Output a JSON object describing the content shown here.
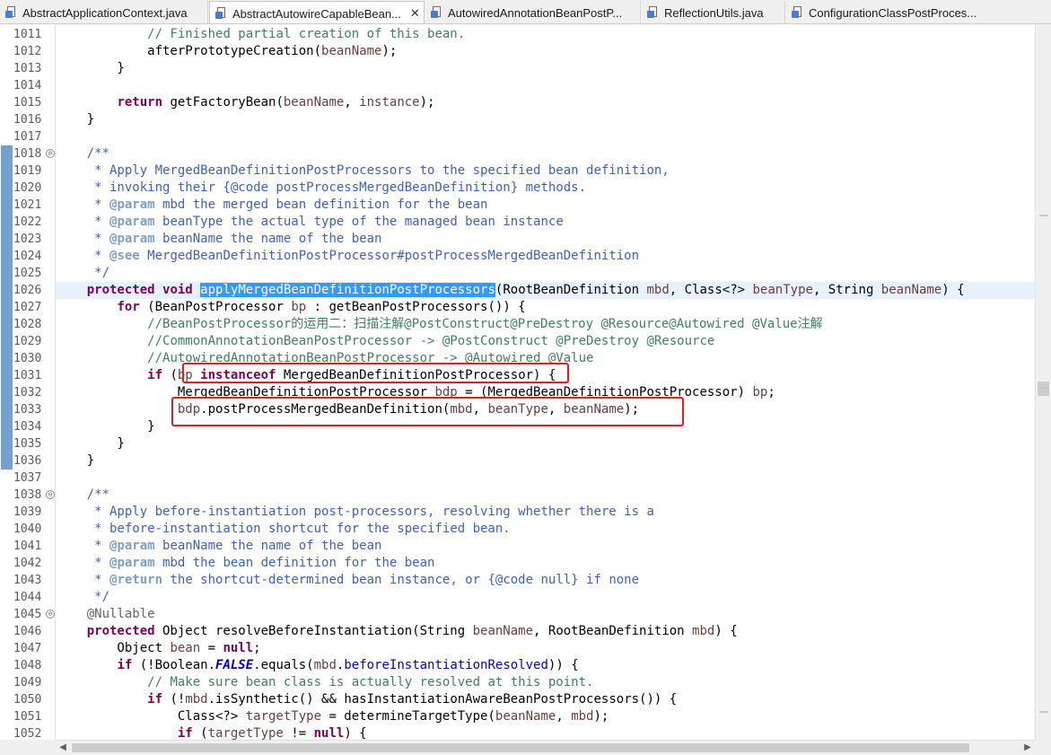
{
  "tabs": [
    {
      "label": "AbstractApplicationContext.java",
      "active": false
    },
    {
      "label": "AbstractAutowireCapableBean...",
      "active": true,
      "close": "✕"
    },
    {
      "label": "AutowiredAnnotationBeanPostP...",
      "active": false
    },
    {
      "label": "ReflectionUtils.java",
      "active": false
    },
    {
      "label": "ConfigurationClassPostProces...",
      "active": false
    }
  ],
  "colors": {
    "keyword": "#7f0055",
    "comment": "#3f7f5f",
    "javadoc": "#3f5fbf",
    "javadoc_tag": "#7f9fbf",
    "local_variable": "#6a3e3e",
    "field": "#0000c0",
    "selection": "#3399ff",
    "highlight_box": "#e02020",
    "current_line": "#e8f2fe"
  },
  "editor": {
    "lines": [
      {
        "num": "1011",
        "segs": [
          {
            "t": "            "
          },
          {
            "t": "// Finished partial creation of this bean.",
            "c": "cm"
          }
        ]
      },
      {
        "num": "1012",
        "segs": [
          {
            "t": "            afterPrototypeCreation("
          },
          {
            "t": "beanName",
            "c": "var"
          },
          {
            "t": ");"
          }
        ]
      },
      {
        "num": "1013",
        "segs": [
          {
            "t": "        }"
          }
        ]
      },
      {
        "num": "1014",
        "segs": [
          {
            "t": ""
          }
        ]
      },
      {
        "num": "1015",
        "segs": [
          {
            "t": "        "
          },
          {
            "t": "return",
            "c": "kw"
          },
          {
            "t": " getFactoryBean("
          },
          {
            "t": "beanName",
            "c": "var"
          },
          {
            "t": ", "
          },
          {
            "t": "instance",
            "c": "var"
          },
          {
            "t": ");"
          }
        ]
      },
      {
        "num": "1016",
        "segs": [
          {
            "t": "    }"
          }
        ]
      },
      {
        "num": "1017",
        "segs": [
          {
            "t": ""
          }
        ]
      },
      {
        "num": "1018",
        "fold": "⊖",
        "mark": true,
        "segs": [
          {
            "t": "    "
          },
          {
            "t": "/**",
            "c": "jd"
          }
        ]
      },
      {
        "num": "1019",
        "mark": true,
        "segs": [
          {
            "t": "     * Apply MergedBeanDefinitionPostProcessors to the specified bean definition,",
            "c": "jd"
          }
        ]
      },
      {
        "num": "1020",
        "mark": true,
        "segs": [
          {
            "t": "     * invoking their {@code postProcessMergedBeanDefinition} methods.",
            "c": "jd"
          }
        ]
      },
      {
        "num": "1021",
        "mark": true,
        "segs": [
          {
            "t": "     * ",
            "c": "jd"
          },
          {
            "t": "@param",
            "c": "jt"
          },
          {
            "t": " mbd the merged bean definition for the bean",
            "c": "jd"
          }
        ]
      },
      {
        "num": "1022",
        "mark": true,
        "segs": [
          {
            "t": "     * ",
            "c": "jd"
          },
          {
            "t": "@param",
            "c": "jt"
          },
          {
            "t": " beanType the actual type of the managed bean instance",
            "c": "jd"
          }
        ]
      },
      {
        "num": "1023",
        "mark": true,
        "segs": [
          {
            "t": "     * ",
            "c": "jd"
          },
          {
            "t": "@param",
            "c": "jt"
          },
          {
            "t": " beanName the name of the bean",
            "c": "jd"
          }
        ]
      },
      {
        "num": "1024",
        "mark": true,
        "segs": [
          {
            "t": "     * ",
            "c": "jd"
          },
          {
            "t": "@see",
            "c": "jt"
          },
          {
            "t": " MergedBeanDefinitionPostProcessor#postProcessMergedBeanDefinition",
            "c": "jd"
          }
        ]
      },
      {
        "num": "1025",
        "mark": true,
        "segs": [
          {
            "t": "     */",
            "c": "jd"
          }
        ]
      },
      {
        "num": "1026",
        "mark": true,
        "current": true,
        "segs": [
          {
            "t": "    "
          },
          {
            "t": "protected",
            "c": "kw"
          },
          {
            "t": " "
          },
          {
            "t": "void",
            "c": "kw"
          },
          {
            "t": " "
          },
          {
            "t": "applyMergedBeanDefinitionPostProcessors",
            "c": "sel"
          },
          {
            "t": "(RootBeanDefinition "
          },
          {
            "t": "mbd",
            "c": "var"
          },
          {
            "t": ", Class<?> "
          },
          {
            "t": "beanType",
            "c": "var"
          },
          {
            "t": ", String "
          },
          {
            "t": "beanName",
            "c": "var"
          },
          {
            "t": ") {"
          }
        ]
      },
      {
        "num": "1027",
        "mark": true,
        "segs": [
          {
            "t": "        "
          },
          {
            "t": "for",
            "c": "kw"
          },
          {
            "t": " (BeanPostProcessor "
          },
          {
            "t": "bp",
            "c": "var"
          },
          {
            "t": " : getBeanPostProcessors()) {"
          }
        ]
      },
      {
        "num": "1028",
        "mark": true,
        "segs": [
          {
            "t": "            "
          },
          {
            "t": "//BeanPostProcessor的运用二：扫描注解@PostConstruct@PreDestroy @Resource@Autowired @Value注解",
            "c": "cm"
          }
        ]
      },
      {
        "num": "1029",
        "mark": true,
        "segs": [
          {
            "t": "            "
          },
          {
            "t": "//CommonAnnotationBeanPostProcessor -> @PostConstruct @PreDestroy @Resource",
            "c": "cm"
          }
        ]
      },
      {
        "num": "1030",
        "mark": true,
        "segs": [
          {
            "t": "            "
          },
          {
            "t": "//AutowiredAnnotationBeanPostProcessor -> @Autowired @Value",
            "c": "cm"
          }
        ]
      },
      {
        "num": "1031",
        "mark": true,
        "segs": [
          {
            "t": "            "
          },
          {
            "t": "if",
            "c": "kw"
          },
          {
            "t": " ("
          },
          {
            "t": "bp",
            "c": "var"
          },
          {
            "t": " "
          },
          {
            "t": "instanceof",
            "c": "kw"
          },
          {
            "t": " MergedBeanDefinitionPostProcessor) {"
          }
        ]
      },
      {
        "num": "1032",
        "mark": true,
        "segs": [
          {
            "t": "                MergedBeanDefinitionPostProcessor "
          },
          {
            "t": "bdp",
            "c": "var"
          },
          {
            "t": " = (MergedBeanDefinitionPostProcessor) "
          },
          {
            "t": "bp",
            "c": "var"
          },
          {
            "t": ";"
          }
        ]
      },
      {
        "num": "1033",
        "mark": true,
        "segs": [
          {
            "t": "                "
          },
          {
            "t": "bdp",
            "c": "var"
          },
          {
            "t": ".postProcessMergedBeanDefinition("
          },
          {
            "t": "mbd",
            "c": "var"
          },
          {
            "t": ", "
          },
          {
            "t": "beanType",
            "c": "var"
          },
          {
            "t": ", "
          },
          {
            "t": "beanName",
            "c": "var"
          },
          {
            "t": ");"
          }
        ]
      },
      {
        "num": "1034",
        "mark": true,
        "segs": [
          {
            "t": "            }"
          }
        ]
      },
      {
        "num": "1035",
        "mark": true,
        "segs": [
          {
            "t": "        }"
          }
        ]
      },
      {
        "num": "1036",
        "mark": true,
        "segs": [
          {
            "t": "    }"
          }
        ]
      },
      {
        "num": "1037",
        "segs": [
          {
            "t": ""
          }
        ]
      },
      {
        "num": "1038",
        "fold": "⊖",
        "segs": [
          {
            "t": "    "
          },
          {
            "t": "/**",
            "c": "jd"
          }
        ]
      },
      {
        "num": "1039",
        "segs": [
          {
            "t": "     * Apply before-instantiation post-processors, resolving whether there is a",
            "c": "jd"
          }
        ]
      },
      {
        "num": "1040",
        "segs": [
          {
            "t": "     * before-instantiation shortcut for the specified bean.",
            "c": "jd"
          }
        ]
      },
      {
        "num": "1041",
        "segs": [
          {
            "t": "     * ",
            "c": "jd"
          },
          {
            "t": "@param",
            "c": "jt"
          },
          {
            "t": " beanName the name of the bean",
            "c": "jd"
          }
        ]
      },
      {
        "num": "1042",
        "segs": [
          {
            "t": "     * ",
            "c": "jd"
          },
          {
            "t": "@param",
            "c": "jt"
          },
          {
            "t": " mbd the bean definition for the bean",
            "c": "jd"
          }
        ]
      },
      {
        "num": "1043",
        "segs": [
          {
            "t": "     * ",
            "c": "jd"
          },
          {
            "t": "@return",
            "c": "jt"
          },
          {
            "t": " the shortcut-determined bean instance, or {@code null} if none",
            "c": "jd"
          }
        ]
      },
      {
        "num": "1044",
        "segs": [
          {
            "t": "     */",
            "c": "jd"
          }
        ]
      },
      {
        "num": "1045",
        "fold": "⊖",
        "segs": [
          {
            "t": "    "
          },
          {
            "t": "@Nullable",
            "c": "ann"
          }
        ]
      },
      {
        "num": "1046",
        "segs": [
          {
            "t": "    "
          },
          {
            "t": "protected",
            "c": "kw"
          },
          {
            "t": " Object resolveBeforeInstantiation(String "
          },
          {
            "t": "beanName",
            "c": "var"
          },
          {
            "t": ", RootBeanDefinition "
          },
          {
            "t": "mbd",
            "c": "var"
          },
          {
            "t": ") {"
          }
        ]
      },
      {
        "num": "1047",
        "segs": [
          {
            "t": "        Object "
          },
          {
            "t": "bean",
            "c": "var"
          },
          {
            "t": " = "
          },
          {
            "t": "null",
            "c": "kw"
          },
          {
            "t": ";"
          }
        ]
      },
      {
        "num": "1048",
        "segs": [
          {
            "t": "        "
          },
          {
            "t": "if",
            "c": "kw"
          },
          {
            "t": " (!Boolean."
          },
          {
            "t": "FALSE",
            "c": "cst"
          },
          {
            "t": ".equals("
          },
          {
            "t": "mbd",
            "c": "var"
          },
          {
            "t": "."
          },
          {
            "t": "beforeInstantiationResolved",
            "c": "fld"
          },
          {
            "t": ")) {"
          }
        ]
      },
      {
        "num": "1049",
        "segs": [
          {
            "t": "            "
          },
          {
            "t": "// Make sure bean class is actually resolved at this point.",
            "c": "cm"
          }
        ]
      },
      {
        "num": "1050",
        "segs": [
          {
            "t": "            "
          },
          {
            "t": "if",
            "c": "kw"
          },
          {
            "t": " (!"
          },
          {
            "t": "mbd",
            "c": "var"
          },
          {
            "t": ".isSynthetic() && hasInstantiationAwareBeanPostProcessors()) {"
          }
        ]
      },
      {
        "num": "1051",
        "segs": [
          {
            "t": "                Class<?> "
          },
          {
            "t": "targetType",
            "c": "var"
          },
          {
            "t": " = determineTargetType("
          },
          {
            "t": "beanName",
            "c": "var"
          },
          {
            "t": ", "
          },
          {
            "t": "mbd",
            "c": "var"
          },
          {
            "t": ");"
          }
        ]
      },
      {
        "num": "1052",
        "segs": [
          {
            "t": "                "
          },
          {
            "t": "if",
            "c": "kw"
          },
          {
            "t": " ("
          },
          {
            "t": "targetType",
            "c": "var"
          },
          {
            "t": " != "
          },
          {
            "t": "null",
            "c": "kw"
          },
          {
            "t": ") {"
          }
        ]
      }
    ]
  }
}
